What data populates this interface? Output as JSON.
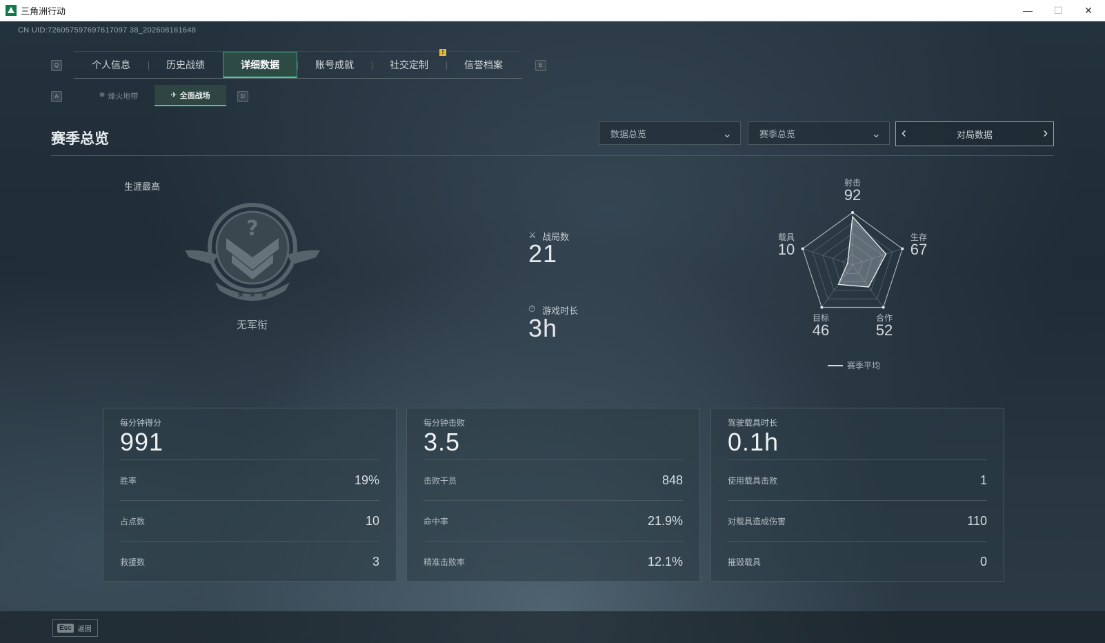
{
  "window": {
    "title": "三角洲行动",
    "controls": {
      "minimize": "—",
      "maximize": "☐",
      "close": "✕"
    }
  },
  "uid": "CN UID:726057597697617097 38_202608161648",
  "tabs": {
    "prev_key": "Q",
    "next_key": "E",
    "items": [
      "个人信息",
      "历史战绩",
      "详细数据",
      "账号成就",
      "社交定制",
      "信誉档案"
    ],
    "active_index": 2,
    "notify_badge": "!"
  },
  "subtabs": {
    "prev_key": "A",
    "next_key": "D",
    "items": [
      "烽火地带",
      "全面战场"
    ],
    "active_index": 1
  },
  "section": {
    "title": "赛季总览",
    "dropdown1": "数据总览",
    "dropdown2": "赛季总览",
    "pager": "对局数据"
  },
  "career": {
    "label": "生涯最高",
    "rank_name": "无军衔"
  },
  "center_stats": {
    "battles_label": "战局数",
    "battles_value": "21",
    "playtime_label": "游戏时长",
    "playtime_value": "3h"
  },
  "radar": {
    "axes": [
      {
        "label": "射击",
        "value": "92"
      },
      {
        "label": "生存",
        "value": "67"
      },
      {
        "label": "合作",
        "value": "52"
      },
      {
        "label": "目标",
        "value": "46"
      },
      {
        "label": "载具",
        "value": "10"
      }
    ],
    "legend": "赛季平均",
    "scale_max": 100
  },
  "cards": [
    {
      "head_label": "每分钟得分",
      "head_value": "991",
      "rows": [
        {
          "label": "胜率",
          "value": "19%"
        },
        {
          "label": "占点数",
          "value": "10"
        },
        {
          "label": "救援数",
          "value": "3"
        }
      ]
    },
    {
      "head_label": "每分钟击败",
      "head_value": "3.5",
      "rows": [
        {
          "label": "击败干员",
          "value": "848"
        },
        {
          "label": "命中率",
          "value": "21.9%"
        },
        {
          "label": "精准击败率",
          "value": "12.1%"
        }
      ]
    },
    {
      "head_label": "驾驶载具时长",
      "head_value": "0.1h",
      "rows": [
        {
          "label": "使用载具击败",
          "value": "1"
        },
        {
          "label": "对载具造成伤害",
          "value": "110"
        },
        {
          "label": "摧毁载具",
          "value": "0"
        }
      ]
    }
  ],
  "footer": {
    "esc_key": "Esc",
    "esc_label": "返回"
  }
}
